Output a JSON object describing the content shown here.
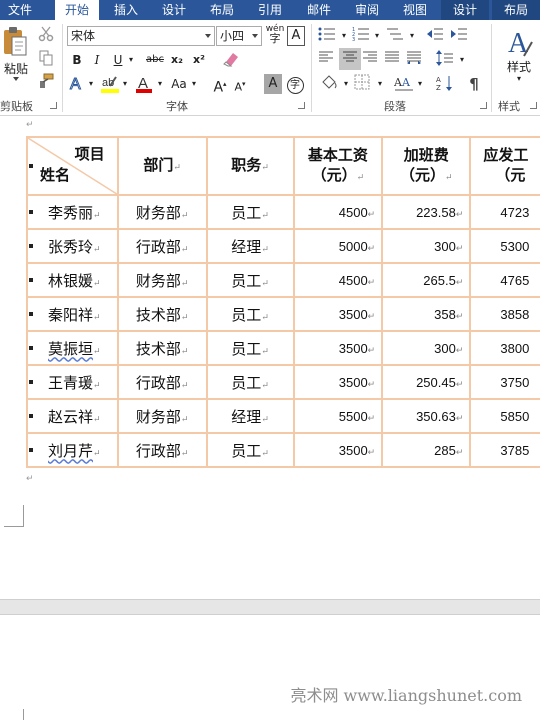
{
  "tabs": [
    {
      "label": "文件"
    },
    {
      "label": "开始",
      "active": true
    },
    {
      "label": "插入"
    },
    {
      "label": "设计"
    },
    {
      "label": "布局"
    },
    {
      "label": "引用"
    },
    {
      "label": "邮件"
    },
    {
      "label": "审阅"
    },
    {
      "label": "视图"
    },
    {
      "label": "设计"
    },
    {
      "label": "布局"
    }
  ],
  "ribbon": {
    "clipboard": {
      "paste_label": "粘贴",
      "group_label": "剪贴板"
    },
    "font": {
      "font_name": "宋体",
      "font_size": "小四",
      "bold": "B",
      "italic": "I",
      "underline": "U",
      "strike": "abc",
      "subscript": "x₂",
      "superscript": "x²",
      "font_color": "A",
      "change_case": "Aa",
      "grow": "A",
      "shrink": "A",
      "char_shading": "A",
      "enclose": "字",
      "phonetic": "wén",
      "border_char": "A",
      "group_label": "字体"
    },
    "paragraph": {
      "group_label": "段落"
    },
    "styles": {
      "label": "样式",
      "group_label": "样式"
    }
  },
  "colors": {
    "accent": "#2b579a",
    "table_border": "#f4c9a8",
    "highlight": "#ffff00",
    "font_color": "#e00000"
  },
  "table": {
    "header": {
      "corner_top": "项目",
      "corner_bottom": "姓名",
      "columns": [
        {
          "line1": "部门",
          "line2": ""
        },
        {
          "line1": "职务",
          "line2": ""
        },
        {
          "line1": "基本工资",
          "line2": "（元）"
        },
        {
          "line1": "加班费",
          "line2": "（元）"
        },
        {
          "line1": "应发工",
          "line2": "（元"
        }
      ]
    },
    "rows": [
      {
        "name": "李秀丽",
        "dept": "财务部",
        "title": "员工",
        "base": "4500",
        "overtime": "223.58",
        "total": "4723"
      },
      {
        "name": "张秀玲",
        "dept": "行政部",
        "title": "经理",
        "base": "5000",
        "overtime": "300",
        "total": "5300"
      },
      {
        "name": "林银媛",
        "dept": "财务部",
        "title": "员工",
        "base": "4500",
        "overtime": "265.5",
        "total": "4765"
      },
      {
        "name": "秦阳祥",
        "dept": "技术部",
        "title": "员工",
        "base": "3500",
        "overtime": "358",
        "total": "3858"
      },
      {
        "name": "莫振垣",
        "dept": "技术部",
        "title": "员工",
        "base": "3500",
        "overtime": "300",
        "total": "3800"
      },
      {
        "name": "王青瑗",
        "dept": "行政部",
        "title": "员工",
        "base": "3500",
        "overtime": "250.45",
        "total": "3750"
      },
      {
        "name": "赵云祥",
        "dept": "财务部",
        "title": "经理",
        "base": "5500",
        "overtime": "350.63",
        "total": "5850"
      },
      {
        "name": "刘月芹",
        "dept": "行政部",
        "title": "员工",
        "base": "3500",
        "overtime": "285",
        "total": "3785"
      }
    ]
  },
  "watermark": "亮术网 www.liangshunet.com"
}
